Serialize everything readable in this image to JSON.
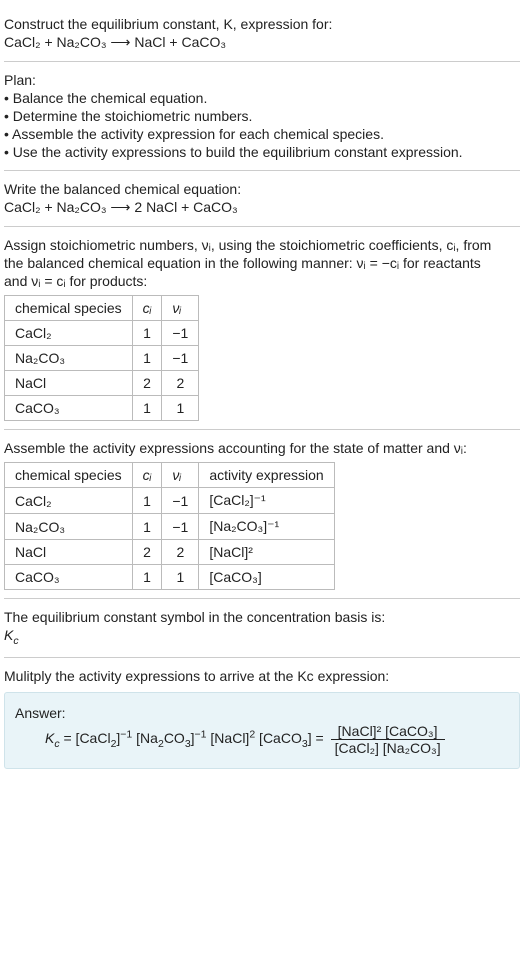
{
  "intro": {
    "l1": "Construct the equilibrium constant, K, expression for:",
    "l2": "CaCl₂ + Na₂CO₃ ⟶ NaCl + CaCO₃"
  },
  "plan": {
    "h": "Plan:",
    "b1": "• Balance the chemical equation.",
    "b2": "• Determine the stoichiometric numbers.",
    "b3": "• Assemble the activity expression for each chemical species.",
    "b4": "• Use the activity expressions to build the equilibrium constant expression."
  },
  "balanced": {
    "h": "Write the balanced chemical equation:",
    "eq": "CaCl₂ + Na₂CO₃ ⟶ 2 NaCl + CaCO₃"
  },
  "stoich": {
    "h1": "Assign stoichiometric numbers, νᵢ, using the stoichiometric coefficients, cᵢ, from",
    "h2": "the balanced chemical equation in the following manner: νᵢ = −cᵢ for reactants",
    "h3": "and νᵢ = cᵢ for products:",
    "headers": {
      "a": "chemical species",
      "b": "cᵢ",
      "c": "νᵢ"
    },
    "rows": [
      {
        "s": "CaCl₂",
        "c": "1",
        "v": "−1"
      },
      {
        "s": "Na₂CO₃",
        "c": "1",
        "v": "−1"
      },
      {
        "s": "NaCl",
        "c": "2",
        "v": "2"
      },
      {
        "s": "CaCO₃",
        "c": "1",
        "v": "1"
      }
    ]
  },
  "activity": {
    "h": "Assemble the activity expressions accounting for the state of matter and νᵢ:",
    "headers": {
      "a": "chemical species",
      "b": "cᵢ",
      "c": "νᵢ",
      "d": "activity expression"
    },
    "rows": [
      {
        "s": "CaCl₂",
        "c": "1",
        "v": "−1",
        "e": "[CaCl₂]⁻¹"
      },
      {
        "s": "Na₂CO₃",
        "c": "1",
        "v": "−1",
        "e": "[Na₂CO₃]⁻¹"
      },
      {
        "s": "NaCl",
        "c": "2",
        "v": "2",
        "e": "[NaCl]²"
      },
      {
        "s": "CaCO₃",
        "c": "1",
        "v": "1",
        "e": "[CaCO₃]"
      }
    ]
  },
  "kc_symbol": {
    "h": "The equilibrium constant symbol in the concentration basis is:",
    "s": "K𞁞",
    "s2": "c"
  },
  "mult": {
    "h": "Mulitply the activity expressions to arrive at the Kc expression:"
  },
  "answer": {
    "label": "Answer:",
    "lhs": "Kc = [CaCl₂]⁻¹ [Na₂CO₃]⁻¹ [NaCl]² [CaCO₃] =",
    "num": "[NaCl]² [CaCO₃]",
    "den": "[CaCl₂] [Na₂CO₃]"
  },
  "chart_data": {
    "type": "table",
    "tables": [
      {
        "title": "Stoichiometric numbers",
        "columns": [
          "chemical species",
          "c_i",
          "ν_i"
        ],
        "rows": [
          [
            "CaCl2",
            1,
            -1
          ],
          [
            "Na2CO3",
            1,
            -1
          ],
          [
            "NaCl",
            2,
            2
          ],
          [
            "CaCO3",
            1,
            1
          ]
        ]
      },
      {
        "title": "Activity expressions",
        "columns": [
          "chemical species",
          "c_i",
          "ν_i",
          "activity expression"
        ],
        "rows": [
          [
            "CaCl2",
            1,
            -1,
            "[CaCl2]^-1"
          ],
          [
            "Na2CO3",
            1,
            -1,
            "[Na2CO3]^-1"
          ],
          [
            "NaCl",
            2,
            2,
            "[NaCl]^2"
          ],
          [
            "CaCO3",
            1,
            1,
            "[CaCO3]"
          ]
        ]
      }
    ]
  }
}
